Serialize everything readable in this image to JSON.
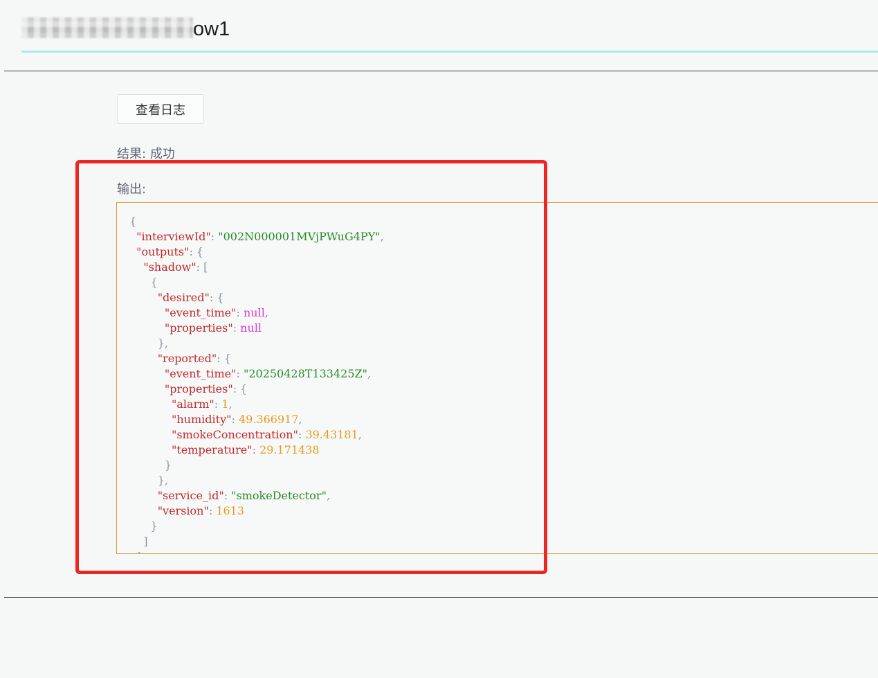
{
  "header": {
    "title_redacted": "",
    "title_suffix": "ow1"
  },
  "actions": {
    "view_log_label": "查看日志"
  },
  "result": {
    "label": "结果:",
    "value": "成功"
  },
  "output": {
    "label": "输出:",
    "json": {
      "interviewId": "002N000001MVjPWuG4PY",
      "desired_event_time": "null",
      "desired_properties": "null",
      "reported_event_time": "20250428T133425Z",
      "alarm": "1",
      "humidity": "49.366917",
      "smokeConcentration": "39.43181",
      "temperature": "29.171438",
      "service_id": "smokeDetector",
      "version": "1613"
    }
  },
  "colors": {
    "highlight": "#ee2520",
    "title_underline": "#ade8ee",
    "output_border": "#c9a448"
  }
}
